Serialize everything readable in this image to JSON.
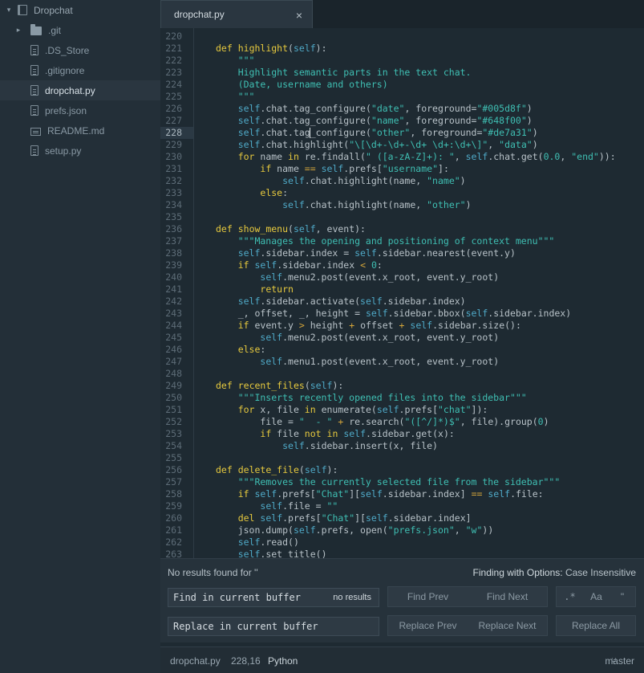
{
  "tree": {
    "root": "Dropchat",
    "items": [
      {
        "label": ".git",
        "type": "folder"
      },
      {
        "label": ".DS_Store",
        "type": "file"
      },
      {
        "label": ".gitignore",
        "type": "file"
      },
      {
        "label": "dropchat.py",
        "type": "file"
      },
      {
        "label": "prefs.json",
        "type": "file"
      },
      {
        "label": "README.md",
        "type": "file"
      },
      {
        "label": "setup.py",
        "type": "file"
      }
    ]
  },
  "tabs": [
    {
      "label": "dropchat.py",
      "close": "×"
    }
  ],
  "editor": {
    "active_line": "228",
    "lines": [
      {
        "n": "220",
        "t": ""
      },
      {
        "n": "221",
        "t": "def highlight(self):"
      },
      {
        "n": "222",
        "t": "    \"\"\""
      },
      {
        "n": "223",
        "t": "    Highlight semantic parts in the text chat."
      },
      {
        "n": "224",
        "t": "    (Date, username and others)"
      },
      {
        "n": "225",
        "t": "    \"\"\""
      },
      {
        "n": "226",
        "t": "    self.chat.tag_configure(\"date\", foreground=\"#005d8f\")"
      },
      {
        "n": "227",
        "t": "    self.chat.tag_configure(\"name\", foreground=\"#648f00\")"
      },
      {
        "n": "228",
        "t": "    self.chat.tag_configure(\"other\", foreground=\"#de7a31\")"
      },
      {
        "n": "229",
        "t": "    self.chat.highlight(\"\\[\\d+-\\d+-\\d+ \\d+:\\d+\\]\", \"data\")"
      },
      {
        "n": "230",
        "t": "    for name in re.findall(\" ([a-zA-Z]+): \", self.chat.get(0.0, \"end\")):"
      },
      {
        "n": "231",
        "t": "        if name == self.prefs[\"username\"]:"
      },
      {
        "n": "232",
        "t": "            self.chat.highlight(name, \"name\")"
      },
      {
        "n": "233",
        "t": "        else:"
      },
      {
        "n": "234",
        "t": "            self.chat.highlight(name, \"other\")"
      },
      {
        "n": "235",
        "t": ""
      },
      {
        "n": "236",
        "t": "def show_menu(self, event):"
      },
      {
        "n": "237",
        "t": "    \"\"\"Manages the opening and positioning of context menu\"\"\""
      },
      {
        "n": "238",
        "t": "    self.sidebar.index = self.sidebar.nearest(event.y)"
      },
      {
        "n": "239",
        "t": "    if self.sidebar.index < 0:"
      },
      {
        "n": "240",
        "t": "        self.menu2.post(event.x_root, event.y_root)"
      },
      {
        "n": "241",
        "t": "        return"
      },
      {
        "n": "242",
        "t": "    self.sidebar.activate(self.sidebar.index)"
      },
      {
        "n": "243",
        "t": "    _, offset, _, height = self.sidebar.bbox(self.sidebar.index)"
      },
      {
        "n": "244",
        "t": "    if event.y > height + offset + self.sidebar.size():"
      },
      {
        "n": "245",
        "t": "        self.menu2.post(event.x_root, event.y_root)"
      },
      {
        "n": "246",
        "t": "    else:"
      },
      {
        "n": "247",
        "t": "        self.menu1.post(event.x_root, event.y_root)"
      },
      {
        "n": "248",
        "t": ""
      },
      {
        "n": "249",
        "t": "def recent_files(self):"
      },
      {
        "n": "250",
        "t": "    \"\"\"Inserts recently opened files into the sidebar\"\"\""
      },
      {
        "n": "251",
        "t": "    for x, file in enumerate(self.prefs[\"chat\"]):"
      },
      {
        "n": "252",
        "t": "        file = \"  - \" + re.search(\"([^/]*)$\", file).group(0)"
      },
      {
        "n": "253",
        "t": "        if file not in self.sidebar.get(x):"
      },
      {
        "n": "254",
        "t": "            self.sidebar.insert(x, file)"
      },
      {
        "n": "255",
        "t": ""
      },
      {
        "n": "256",
        "t": "def delete_file(self):"
      },
      {
        "n": "257",
        "t": "    \"\"\"Removes the currently selected file from the sidebar\"\"\""
      },
      {
        "n": "258",
        "t": "    if self.prefs[\"Chat\"][self.sidebar.index] == self.file:"
      },
      {
        "n": "259",
        "t": "        self.file = \"\""
      },
      {
        "n": "260",
        "t": "    del self.prefs[\"Chat\"][self.sidebar.index]"
      },
      {
        "n": "261",
        "t": "    json.dump(self.prefs, open(\"prefs.json\", \"w\"))"
      },
      {
        "n": "262",
        "t": "    self.read()"
      },
      {
        "n": "263",
        "t": "    self.set_title()"
      }
    ]
  },
  "find": {
    "message": "No results found for ''",
    "options_label": "Finding with Options:",
    "options_value": "Case Insensitive",
    "find_placeholder": "Find in current buffer",
    "find_hint": "no results",
    "replace_placeholder": "Replace in current buffer",
    "find_prev": "Find Prev",
    "find_next": "Find Next",
    "regex_toggle": ".*",
    "case_toggle": "Aa",
    "whole_word_toggle": "\"",
    "replace_prev": "Replace Prev",
    "replace_next": "Replace Next",
    "replace_all": "Replace All"
  },
  "status": {
    "file": "dropchat.py",
    "cursor": "228,16",
    "grammar": "Python",
    "branch": "master"
  },
  "colors": {
    "background": "#1e2a32",
    "keyword": "#e6c93e",
    "string": "#3fbfb3",
    "self": "#4fa9c7"
  }
}
